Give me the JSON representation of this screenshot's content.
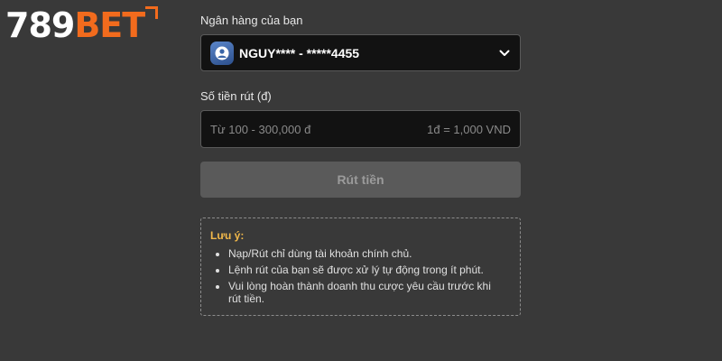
{
  "brand": {
    "logo_number": "789",
    "logo_text": "BET",
    "accent_color": "#f26b1d"
  },
  "bank": {
    "label": "Ngân hàng của bạn",
    "selected_account": "NGUY**** - *****4455",
    "icon": "bank-user-icon",
    "dropdown_icon": "chevron-down-icon"
  },
  "amount": {
    "label": "Số tiền rút (đ)",
    "value": "",
    "placeholder": "Từ 100 - 300,000 đ",
    "conversion_hint": "1đ = 1,000 VND"
  },
  "submit": {
    "label": "Rút tiền",
    "enabled": false
  },
  "notice": {
    "title": "Lưu ý:",
    "title_color": "#f2b94a",
    "items": [
      "Nạp/Rút chỉ dùng tài khoản chính chủ.",
      "Lệnh rút của bạn sẽ được xử lý tự động trong ít phút.",
      "Vui lòng hoàn thành doanh thu cược yêu cầu trước khi rút tiền."
    ]
  }
}
